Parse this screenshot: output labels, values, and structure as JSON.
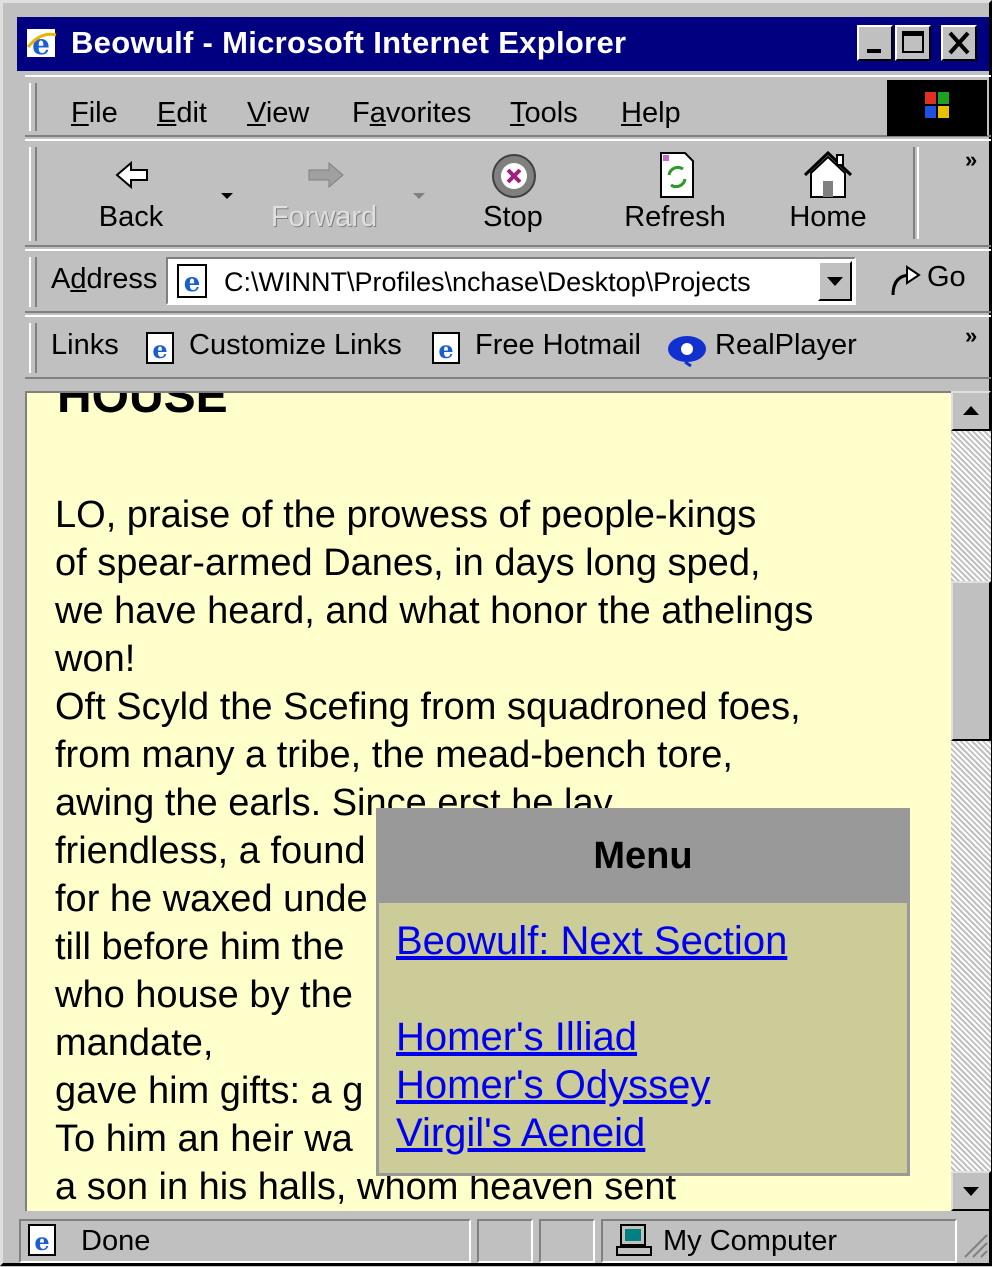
{
  "window": {
    "title": "Beowulf - Microsoft Internet Explorer"
  },
  "menubar": {
    "items": [
      "File",
      "Edit",
      "View",
      "Favorites",
      "Tools",
      "Help"
    ],
    "mnemonics": [
      "F",
      "E",
      "V",
      "a",
      "T",
      "H"
    ]
  },
  "toolbar": {
    "back": "Back",
    "forward": "Forward",
    "stop": "Stop",
    "refresh": "Refresh",
    "home": "Home"
  },
  "address": {
    "label": "Address",
    "value": "C:\\WINNT\\Profiles\\nchase\\Desktop\\Projects",
    "go": "Go"
  },
  "links": {
    "label": "Links",
    "items": [
      "Customize Links",
      "Free Hotmail",
      "RealPlayer"
    ]
  },
  "page": {
    "heading_partial": "HOUSE",
    "lines": [
      "LO, praise of the prowess of people-kings",
      "of spear-armed Danes, in days long sped,",
      "we have heard, and what honor the athelings",
      "won!",
      "Oft Scyld the Scefing from squadroned foes,",
      "from many a tribe, the mead-bench tore,",
      "awing the earls. Since erst he lay",
      "friendless, a found",
      "for he waxed unde",
      "till before him the",
      "who house by the",
      "mandate,",
      "gave him gifts: a g",
      "To him an heir wa",
      "a son in his halls, whom heaven sent"
    ]
  },
  "menu_popup": {
    "title": "Menu",
    "links": [
      "Beowulf: Next Section",
      "Homer's Illiad",
      "Homer's Odyssey",
      "Virgil's Aeneid"
    ]
  },
  "statusbar": {
    "text": "Done",
    "zone": "My Computer"
  },
  "colors": {
    "titlebar": "#000080",
    "page_bg": "#ffffcc",
    "popup_bg": "#cccc99",
    "popup_header": "#999999",
    "link": "#0000ee"
  }
}
